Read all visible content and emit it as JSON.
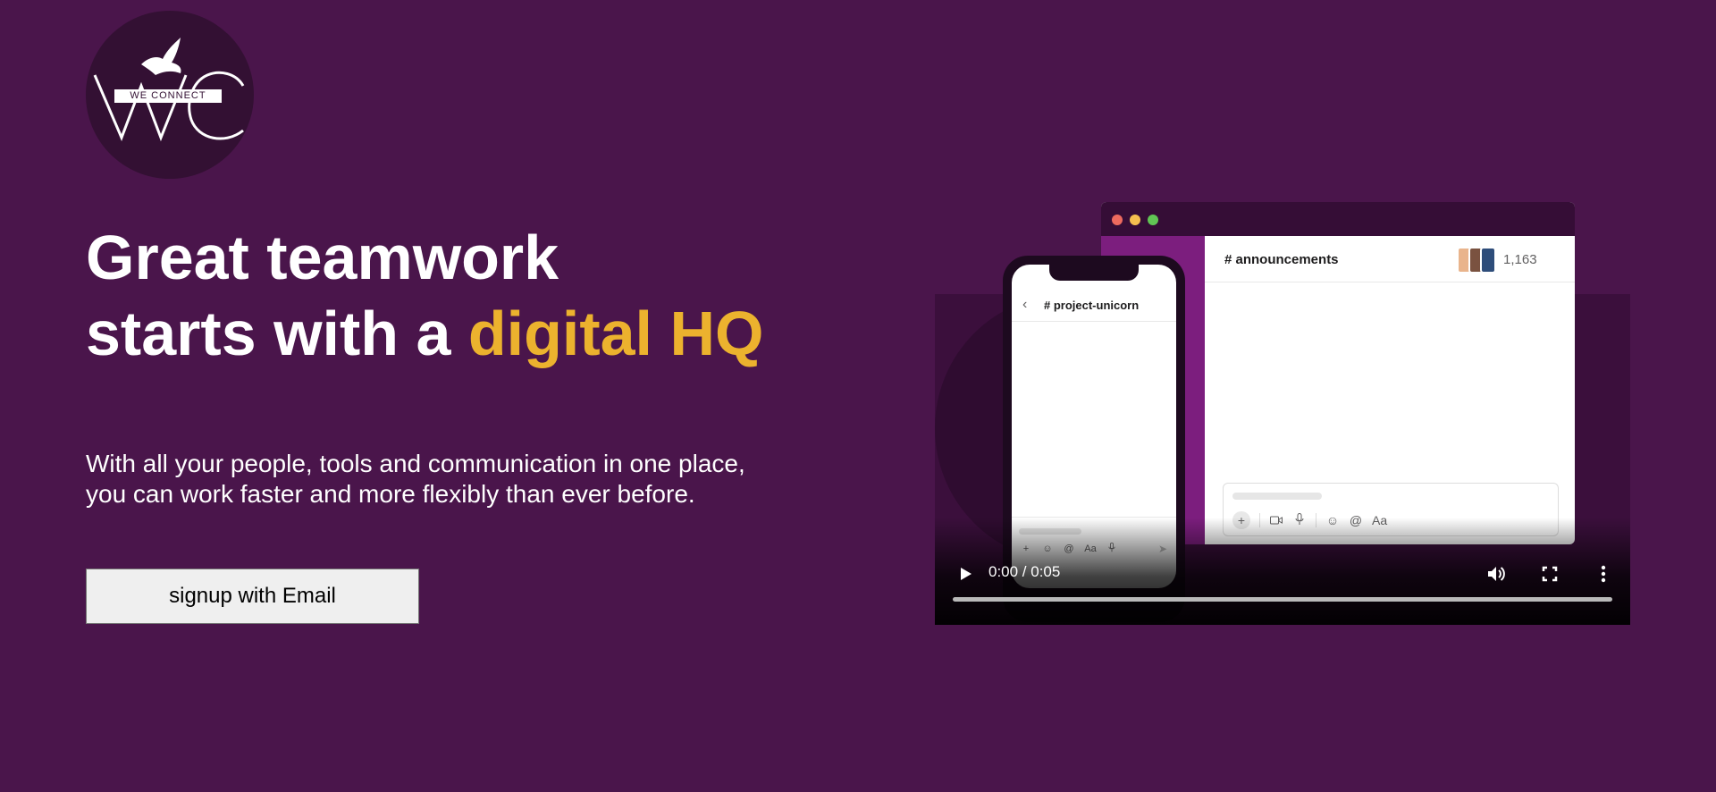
{
  "logo": {
    "band_text": "WE CONNECT"
  },
  "hero": {
    "headline_line1": "Great teamwork",
    "headline_line2_start": "starts with a ",
    "headline_accent": "digital HQ",
    "subtext": "With all your people, tools and communication in one place, you can work faster and more flexibly than ever before.",
    "signup_button": "signup with Email"
  },
  "video": {
    "current_time": "0:00",
    "duration": "0:05",
    "time_display": "0:00 / 0:05",
    "progress_fraction": 0.0,
    "desktop": {
      "channel": "# announcements",
      "member_count": "1,163",
      "format_label": "Aa"
    },
    "phone": {
      "channel": "# project-unicorn",
      "format_label": "Aa"
    }
  },
  "colors": {
    "background": "#4a154b",
    "accent": "#ecb22e"
  },
  "icons": {
    "play": "play-icon",
    "volume": "volume-icon",
    "fullscreen": "fullscreen-icon",
    "more": "more-vertical-icon"
  }
}
